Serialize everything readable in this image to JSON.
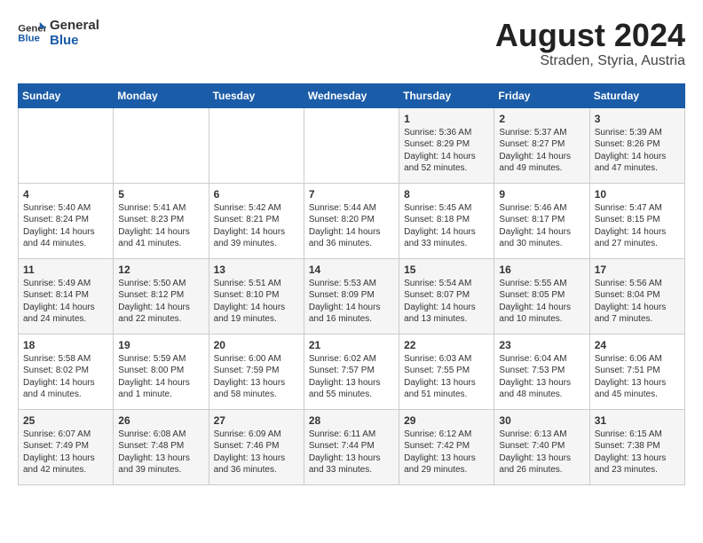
{
  "logo": {
    "line1": "General",
    "line2": "Blue"
  },
  "title": "August 2024",
  "location": "Straden, Styria, Austria",
  "weekdays": [
    "Sunday",
    "Monday",
    "Tuesday",
    "Wednesday",
    "Thursday",
    "Friday",
    "Saturday"
  ],
  "weeks": [
    [
      {
        "day": "",
        "content": ""
      },
      {
        "day": "",
        "content": ""
      },
      {
        "day": "",
        "content": ""
      },
      {
        "day": "",
        "content": ""
      },
      {
        "day": "1",
        "content": "Sunrise: 5:36 AM\nSunset: 8:29 PM\nDaylight: 14 hours\nand 52 minutes."
      },
      {
        "day": "2",
        "content": "Sunrise: 5:37 AM\nSunset: 8:27 PM\nDaylight: 14 hours\nand 49 minutes."
      },
      {
        "day": "3",
        "content": "Sunrise: 5:39 AM\nSunset: 8:26 PM\nDaylight: 14 hours\nand 47 minutes."
      }
    ],
    [
      {
        "day": "4",
        "content": "Sunrise: 5:40 AM\nSunset: 8:24 PM\nDaylight: 14 hours\nand 44 minutes."
      },
      {
        "day": "5",
        "content": "Sunrise: 5:41 AM\nSunset: 8:23 PM\nDaylight: 14 hours\nand 41 minutes."
      },
      {
        "day": "6",
        "content": "Sunrise: 5:42 AM\nSunset: 8:21 PM\nDaylight: 14 hours\nand 39 minutes."
      },
      {
        "day": "7",
        "content": "Sunrise: 5:44 AM\nSunset: 8:20 PM\nDaylight: 14 hours\nand 36 minutes."
      },
      {
        "day": "8",
        "content": "Sunrise: 5:45 AM\nSunset: 8:18 PM\nDaylight: 14 hours\nand 33 minutes."
      },
      {
        "day": "9",
        "content": "Sunrise: 5:46 AM\nSunset: 8:17 PM\nDaylight: 14 hours\nand 30 minutes."
      },
      {
        "day": "10",
        "content": "Sunrise: 5:47 AM\nSunset: 8:15 PM\nDaylight: 14 hours\nand 27 minutes."
      }
    ],
    [
      {
        "day": "11",
        "content": "Sunrise: 5:49 AM\nSunset: 8:14 PM\nDaylight: 14 hours\nand 24 minutes."
      },
      {
        "day": "12",
        "content": "Sunrise: 5:50 AM\nSunset: 8:12 PM\nDaylight: 14 hours\nand 22 minutes."
      },
      {
        "day": "13",
        "content": "Sunrise: 5:51 AM\nSunset: 8:10 PM\nDaylight: 14 hours\nand 19 minutes."
      },
      {
        "day": "14",
        "content": "Sunrise: 5:53 AM\nSunset: 8:09 PM\nDaylight: 14 hours\nand 16 minutes."
      },
      {
        "day": "15",
        "content": "Sunrise: 5:54 AM\nSunset: 8:07 PM\nDaylight: 14 hours\nand 13 minutes."
      },
      {
        "day": "16",
        "content": "Sunrise: 5:55 AM\nSunset: 8:05 PM\nDaylight: 14 hours\nand 10 minutes."
      },
      {
        "day": "17",
        "content": "Sunrise: 5:56 AM\nSunset: 8:04 PM\nDaylight: 14 hours\nand 7 minutes."
      }
    ],
    [
      {
        "day": "18",
        "content": "Sunrise: 5:58 AM\nSunset: 8:02 PM\nDaylight: 14 hours\nand 4 minutes."
      },
      {
        "day": "19",
        "content": "Sunrise: 5:59 AM\nSunset: 8:00 PM\nDaylight: 14 hours\nand 1 minute."
      },
      {
        "day": "20",
        "content": "Sunrise: 6:00 AM\nSunset: 7:59 PM\nDaylight: 13 hours\nand 58 minutes."
      },
      {
        "day": "21",
        "content": "Sunrise: 6:02 AM\nSunset: 7:57 PM\nDaylight: 13 hours\nand 55 minutes."
      },
      {
        "day": "22",
        "content": "Sunrise: 6:03 AM\nSunset: 7:55 PM\nDaylight: 13 hours\nand 51 minutes."
      },
      {
        "day": "23",
        "content": "Sunrise: 6:04 AM\nSunset: 7:53 PM\nDaylight: 13 hours\nand 48 minutes."
      },
      {
        "day": "24",
        "content": "Sunrise: 6:06 AM\nSunset: 7:51 PM\nDaylight: 13 hours\nand 45 minutes."
      }
    ],
    [
      {
        "day": "25",
        "content": "Sunrise: 6:07 AM\nSunset: 7:49 PM\nDaylight: 13 hours\nand 42 minutes."
      },
      {
        "day": "26",
        "content": "Sunrise: 6:08 AM\nSunset: 7:48 PM\nDaylight: 13 hours\nand 39 minutes."
      },
      {
        "day": "27",
        "content": "Sunrise: 6:09 AM\nSunset: 7:46 PM\nDaylight: 13 hours\nand 36 minutes."
      },
      {
        "day": "28",
        "content": "Sunrise: 6:11 AM\nSunset: 7:44 PM\nDaylight: 13 hours\nand 33 minutes."
      },
      {
        "day": "29",
        "content": "Sunrise: 6:12 AM\nSunset: 7:42 PM\nDaylight: 13 hours\nand 29 minutes."
      },
      {
        "day": "30",
        "content": "Sunrise: 6:13 AM\nSunset: 7:40 PM\nDaylight: 13 hours\nand 26 minutes."
      },
      {
        "day": "31",
        "content": "Sunrise: 6:15 AM\nSunset: 7:38 PM\nDaylight: 13 hours\nand 23 minutes."
      }
    ]
  ]
}
